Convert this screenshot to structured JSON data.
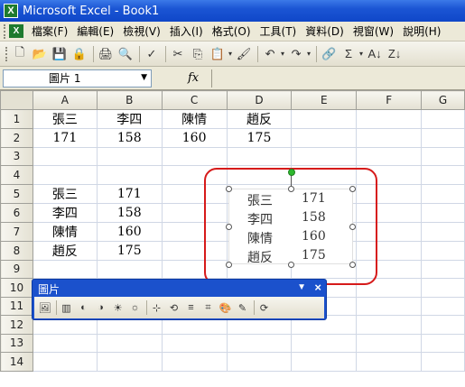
{
  "window": {
    "title": "Microsoft Excel - Book1",
    "icon": "excel-icon"
  },
  "menubar": {
    "items": [
      "檔案(F)",
      "編輯(E)",
      "檢視(V)",
      "插入(I)",
      "格式(O)",
      "工具(T)",
      "資料(D)",
      "視窗(W)",
      "說明(H)"
    ]
  },
  "toolbar": {
    "icons": [
      "new-icon",
      "open-icon",
      "save-icon",
      "permission-icon",
      "print-icon",
      "print-preview-icon",
      "spelling-icon",
      "cut-icon",
      "copy-icon",
      "paste-icon",
      "format-painter-icon",
      "undo-icon",
      "redo-icon",
      "hyperlink-icon",
      "autosum-icon",
      "sort-ascending-icon",
      "sort-descending-icon"
    ],
    "glyphs": {
      "new": "🗋",
      "open": "📂",
      "save": "💾",
      "permission": "🔒",
      "print": "🖨",
      "preview": "🔍",
      "spell": "✓",
      "cut": "✂",
      "copy": "⎘",
      "paste": "📋",
      "painter": "🖌",
      "undo": "↶",
      "redo": "↷",
      "link": "🔗",
      "sum": "Σ",
      "sortasc": "A↓",
      "sortdesc": "Z↓"
    }
  },
  "formulabar": {
    "namebox": "圖片 1",
    "fx": "fx",
    "content": ""
  },
  "sheet": {
    "columns": [
      "A",
      "B",
      "C",
      "D",
      "E",
      "F",
      "G"
    ],
    "rows": [
      {
        "n": "1",
        "cells": [
          "張三",
          "李四",
          "陳情",
          "趙反",
          "",
          "",
          ""
        ]
      },
      {
        "n": "2",
        "cells": [
          "171",
          "158",
          "160",
          "175",
          "",
          "",
          ""
        ]
      },
      {
        "n": "3",
        "cells": [
          "",
          "",
          "",
          "",
          "",
          "",
          ""
        ]
      },
      {
        "n": "4",
        "cells": [
          "",
          "",
          "",
          "",
          "",
          "",
          ""
        ]
      },
      {
        "n": "5",
        "cells": [
          "張三",
          "171",
          "",
          "",
          "",
          "",
          ""
        ]
      },
      {
        "n": "6",
        "cells": [
          "李四",
          "158",
          "",
          "",
          "",
          "",
          ""
        ]
      },
      {
        "n": "7",
        "cells": [
          "陳情",
          "160",
          "",
          "",
          "",
          "",
          ""
        ]
      },
      {
        "n": "8",
        "cells": [
          "趙反",
          "175",
          "",
          "",
          "",
          "",
          ""
        ]
      },
      {
        "n": "9",
        "cells": [
          "",
          "",
          "",
          "",
          "",
          "",
          ""
        ]
      },
      {
        "n": "10",
        "cells": [
          "",
          "",
          "",
          "",
          "",
          "",
          ""
        ]
      },
      {
        "n": "11",
        "cells": [
          "",
          "",
          "",
          "",
          "",
          "",
          ""
        ]
      },
      {
        "n": "12",
        "cells": [
          "",
          "",
          "",
          "",
          "",
          "",
          ""
        ]
      },
      {
        "n": "13",
        "cells": [
          "",
          "",
          "",
          "",
          "",
          "",
          ""
        ]
      },
      {
        "n": "14",
        "cells": [
          "",
          "",
          "",
          "",
          "",
          "",
          ""
        ]
      }
    ]
  },
  "picture": {
    "rows": [
      {
        "name": "張三",
        "value": "171"
      },
      {
        "name": "李四",
        "value": "158"
      },
      {
        "name": "陳情",
        "value": "160"
      },
      {
        "name": "趙反",
        "value": "175"
      }
    ],
    "selection_outline_color": "#d61a1a"
  },
  "picture_toolbar": {
    "title": "圖片",
    "icons": [
      "insert-picture-icon",
      "color-icon",
      "more-contrast-icon",
      "less-contrast-icon",
      "more-brightness-icon",
      "less-brightness-icon",
      "crop-icon",
      "rotate-left-icon",
      "line-style-icon",
      "compress-pictures-icon",
      "format-picture-icon",
      "set-transparent-color-icon",
      "reset-picture-icon"
    ],
    "glyphs": {
      "insert": "🖼",
      "color": "▥",
      "contrast_up": "◐",
      "contrast_down": "◑",
      "bright_up": "☀",
      "bright_down": "☼",
      "crop": "⊹",
      "rotate": "⟲",
      "line": "≡",
      "compress": "⌗",
      "format": "🎨",
      "transparent": "✎",
      "reset": "⟳"
    }
  }
}
